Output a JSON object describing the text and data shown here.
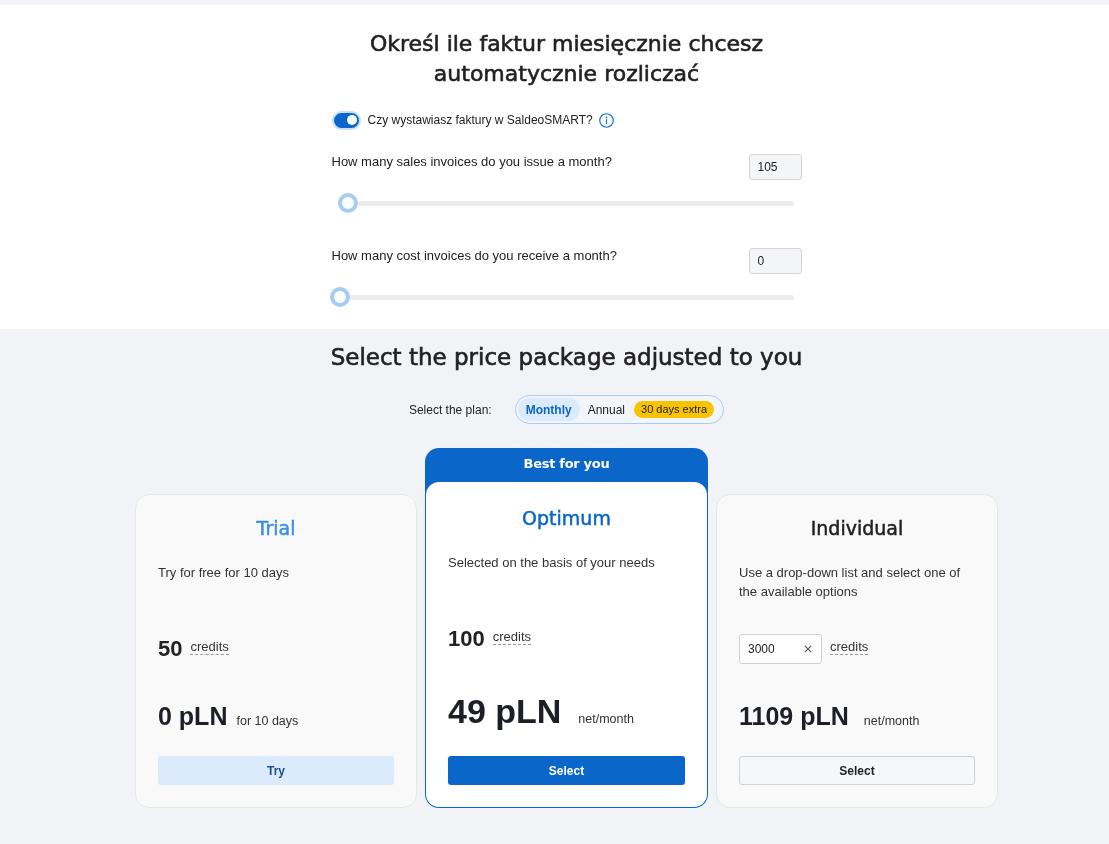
{
  "invoice_form": {
    "title": "Określ ile faktur miesięcznie chcesz automatycznie rozliczać",
    "toggle": {
      "label": "Czy wystawiasz faktury w SaldeoSMART?",
      "on": true
    },
    "questions": [
      {
        "label": "How many sales invoices do you issue a month?",
        "value": "105",
        "level": 0.02
      },
      {
        "label": "How many cost invoices do you receive a month?",
        "value": "0",
        "level": 0
      }
    ]
  },
  "pricing": {
    "title": "Select the price package adjusted to you",
    "plan_label": "Select the plan:",
    "plan_options": [
      {
        "label": "Monthly",
        "selected": true
      },
      {
        "label": "Annual",
        "selected": false,
        "badge": "30 days extra"
      }
    ],
    "packages": [
      {
        "kind": "trial",
        "name": "Trial",
        "description": "Try for free for 10 days",
        "credits": "50",
        "credits_label": "credits",
        "price": "0 pLN",
        "price_note": "for 10 days",
        "button": "Try"
      },
      {
        "kind": "recommended",
        "ribbon": "Best for you",
        "name": "Optimum",
        "description": "Selected on the basis of your needs",
        "credits": "100",
        "credits_label": "credits",
        "price": "49 pLN",
        "price_note": "net/month",
        "button": "Select"
      },
      {
        "kind": "custom",
        "name": "Individual",
        "description": "Use a drop-down list and select one of the available options",
        "credits": "3000",
        "credits_label": "credits",
        "price": "1109 pLN",
        "price_note": "net/month",
        "button": "Select"
      }
    ]
  }
}
